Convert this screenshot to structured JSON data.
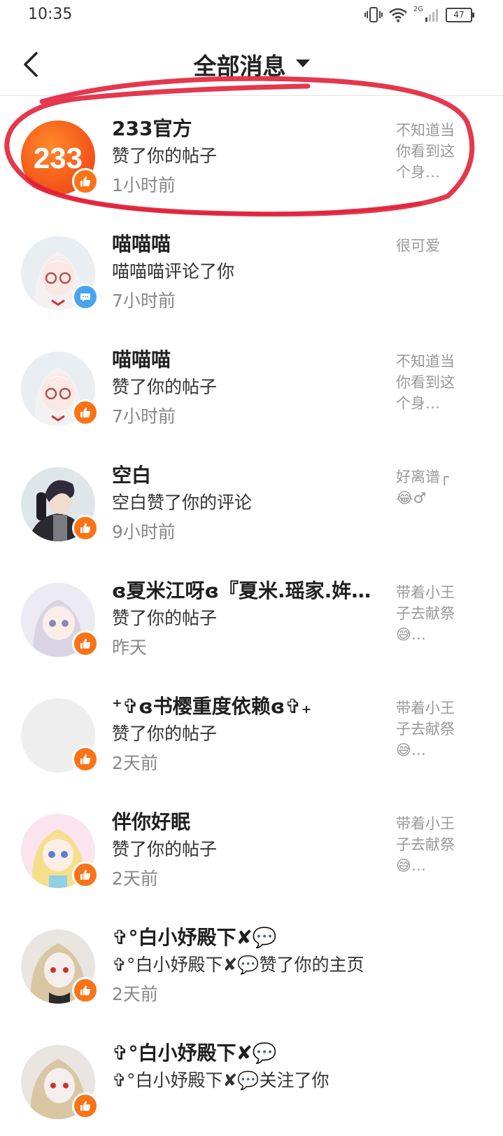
{
  "status_bar": {
    "time": "10:35",
    "network": "2G",
    "battery": "47"
  },
  "header": {
    "title": "全部消息"
  },
  "messages": [
    {
      "name": "233官方",
      "action": "赞了你的帖子",
      "time": "1小时前",
      "preview": "不知道当你看到这个身…",
      "badge": "like"
    },
    {
      "name": "喵喵喵",
      "action": "喵喵喵评论了你",
      "time": "7小时前",
      "preview": "很可爱",
      "badge": "comment"
    },
    {
      "name": "喵喵喵",
      "action": "赞了你的帖子",
      "time": "7小时前",
      "preview": "不知道当你看到这个身…",
      "badge": "like"
    },
    {
      "name": "空白",
      "action": "空白赞了你的评论",
      "time": "9小时前",
      "preview": "好离谱┌😂♂",
      "badge": "like"
    },
    {
      "name": "ɞ夏米江呀ɞ『夏米.瑶家.姩…",
      "action": "赞了你的帖子",
      "time": "昨天",
      "preview": "带着小王子去献祭😅…",
      "badge": "like"
    },
    {
      "name": "⁺✞ɞ书樱重度依赖ɞ✞₊",
      "action": "赞了你的帖子",
      "time": "2天前",
      "preview": "带着小王子去献祭😅…",
      "badge": "like"
    },
    {
      "name": "伴你好眠",
      "action": "赞了你的帖子",
      "time": "2天前",
      "preview": "带着小王子去献祭😅…",
      "badge": "like"
    },
    {
      "name": "✞°白小妤殿下✘💬",
      "action": "✞°白小妤殿下✘💬赞了你的主页",
      "time": "2天前",
      "preview": "",
      "badge": "like"
    },
    {
      "name": "✞°白小妤殿下✘💬",
      "action": "✞°白小妤殿下✘💬关注了你",
      "time": "",
      "preview": "",
      "badge": "like"
    }
  ],
  "colors": {
    "like_badge": "#fa7316",
    "comment_badge": "#4aa3ee",
    "annotation": "#e0223a"
  }
}
